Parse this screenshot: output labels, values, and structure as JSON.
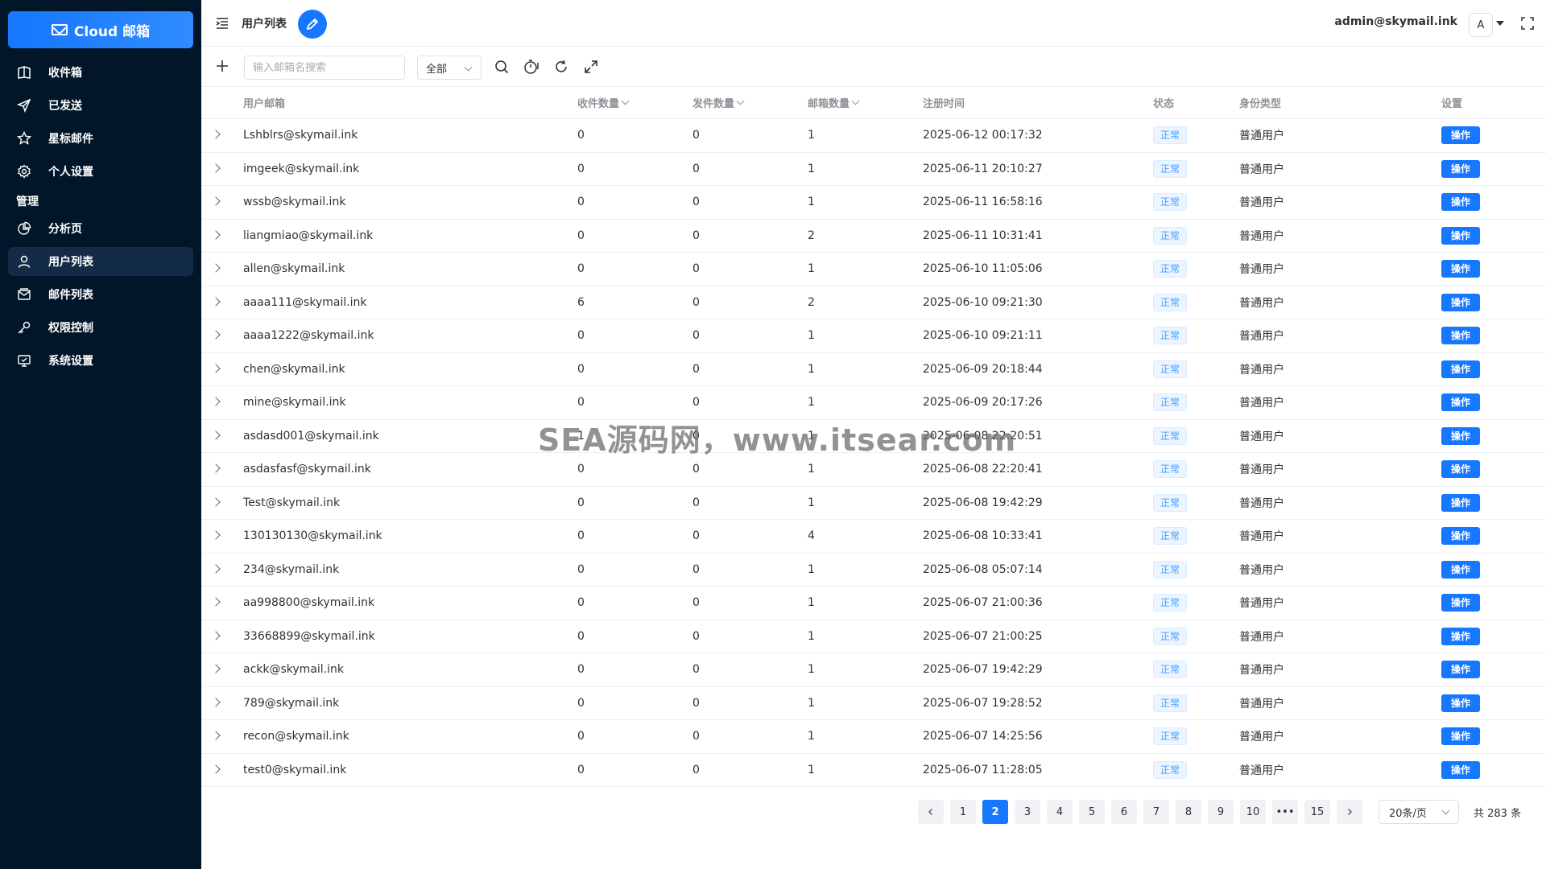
{
  "brand": {
    "label": "Cloud 邮箱"
  },
  "sidebar": {
    "items": [
      {
        "label": "收件箱",
        "icon": "inbox-icon"
      },
      {
        "label": "已发送",
        "icon": "send-icon"
      },
      {
        "label": "星标邮件",
        "icon": "star-icon"
      },
      {
        "label": "个人设置",
        "icon": "gear-icon"
      }
    ],
    "section_label": "管理",
    "admin_items": [
      {
        "label": "分析页",
        "icon": "pie-chart-icon"
      },
      {
        "label": "用户列表",
        "icon": "user-icon",
        "active": true
      },
      {
        "label": "邮件列表",
        "icon": "mail-list-icon"
      },
      {
        "label": "权限控制",
        "icon": "key-icon"
      },
      {
        "label": "系统设置",
        "icon": "monitor-icon"
      }
    ]
  },
  "header": {
    "title": "用户列表",
    "user_email": "admin@skymail.ink",
    "avatar_letter": "A"
  },
  "toolbar": {
    "search_placeholder": "输入邮箱名搜索",
    "filter_value": "全部"
  },
  "table": {
    "headers": {
      "email": "用户邮箱",
      "recv": "收件数量",
      "send": "发件数量",
      "mailbox": "邮箱数量",
      "time": "注册时间",
      "status": "状态",
      "role": "身份类型",
      "settings": "设置"
    },
    "rows": [
      {
        "email": "Lshblrs@skymail.ink",
        "recv": "0",
        "send": "0",
        "mailbox": "1",
        "time": "2025-06-12 00:17:32",
        "status": "正常",
        "role": "普通用户",
        "action": "操作"
      },
      {
        "email": "imgeek@skymail.ink",
        "recv": "0",
        "send": "0",
        "mailbox": "1",
        "time": "2025-06-11 20:10:27",
        "status": "正常",
        "role": "普通用户",
        "action": "操作"
      },
      {
        "email": "wssb@skymail.ink",
        "recv": "0",
        "send": "0",
        "mailbox": "1",
        "time": "2025-06-11 16:58:16",
        "status": "正常",
        "role": "普通用户",
        "action": "操作"
      },
      {
        "email": "liangmiao@skymail.ink",
        "recv": "0",
        "send": "0",
        "mailbox": "2",
        "time": "2025-06-11 10:31:41",
        "status": "正常",
        "role": "普通用户",
        "action": "操作"
      },
      {
        "email": "allen@skymail.ink",
        "recv": "0",
        "send": "0",
        "mailbox": "1",
        "time": "2025-06-10 11:05:06",
        "status": "正常",
        "role": "普通用户",
        "action": "操作"
      },
      {
        "email": "aaaa111@skymail.ink",
        "recv": "6",
        "send": "0",
        "mailbox": "2",
        "time": "2025-06-10 09:21:30",
        "status": "正常",
        "role": "普通用户",
        "action": "操作"
      },
      {
        "email": "aaaa1222@skymail.ink",
        "recv": "0",
        "send": "0",
        "mailbox": "1",
        "time": "2025-06-10 09:21:11",
        "status": "正常",
        "role": "普通用户",
        "action": "操作"
      },
      {
        "email": "chen@skymail.ink",
        "recv": "0",
        "send": "0",
        "mailbox": "1",
        "time": "2025-06-09 20:18:44",
        "status": "正常",
        "role": "普通用户",
        "action": "操作"
      },
      {
        "email": "mine@skymail.ink",
        "recv": "0",
        "send": "0",
        "mailbox": "1",
        "time": "2025-06-09 20:17:26",
        "status": "正常",
        "role": "普通用户",
        "action": "操作"
      },
      {
        "email": "asdasd001@skymail.ink",
        "recv": "1",
        "send": "0",
        "mailbox": "1",
        "time": "2025-06-08 22:20:51",
        "status": "正常",
        "role": "普通用户",
        "action": "操作"
      },
      {
        "email": "asdasfasf@skymail.ink",
        "recv": "0",
        "send": "0",
        "mailbox": "1",
        "time": "2025-06-08 22:20:41",
        "status": "正常",
        "role": "普通用户",
        "action": "操作"
      },
      {
        "email": "Test@skymail.ink",
        "recv": "0",
        "send": "0",
        "mailbox": "1",
        "time": "2025-06-08 19:42:29",
        "status": "正常",
        "role": "普通用户",
        "action": "操作"
      },
      {
        "email": "130130130@skymail.ink",
        "recv": "0",
        "send": "0",
        "mailbox": "4",
        "time": "2025-06-08 10:33:41",
        "status": "正常",
        "role": "普通用户",
        "action": "操作"
      },
      {
        "email": "234@skymail.ink",
        "recv": "0",
        "send": "0",
        "mailbox": "1",
        "time": "2025-06-08 05:07:14",
        "status": "正常",
        "role": "普通用户",
        "action": "操作"
      },
      {
        "email": "aa998800@skymail.ink",
        "recv": "0",
        "send": "0",
        "mailbox": "1",
        "time": "2025-06-07 21:00:36",
        "status": "正常",
        "role": "普通用户",
        "action": "操作"
      },
      {
        "email": "33668899@skymail.ink",
        "recv": "0",
        "send": "0",
        "mailbox": "1",
        "time": "2025-06-07 21:00:25",
        "status": "正常",
        "role": "普通用户",
        "action": "操作"
      },
      {
        "email": "ackk@skymail.ink",
        "recv": "0",
        "send": "0",
        "mailbox": "1",
        "time": "2025-06-07 19:42:29",
        "status": "正常",
        "role": "普通用户",
        "action": "操作"
      },
      {
        "email": "789@skymail.ink",
        "recv": "0",
        "send": "0",
        "mailbox": "1",
        "time": "2025-06-07 19:28:52",
        "status": "正常",
        "role": "普通用户",
        "action": "操作"
      },
      {
        "email": "recon@skymail.ink",
        "recv": "0",
        "send": "0",
        "mailbox": "1",
        "time": "2025-06-07 14:25:56",
        "status": "正常",
        "role": "普通用户",
        "action": "操作"
      },
      {
        "email": "test0@skymail.ink",
        "recv": "0",
        "send": "0",
        "mailbox": "1",
        "time": "2025-06-07 11:28:05",
        "status": "正常",
        "role": "普通用户",
        "action": "操作"
      }
    ]
  },
  "pagination": {
    "pages": [
      "1",
      "2",
      "3",
      "4",
      "5",
      "6",
      "7",
      "8",
      "9",
      "10",
      "•••",
      "15"
    ],
    "current": "2",
    "page_size": "20条/页",
    "total": "共 283 条"
  },
  "watermark": "SEA源码网，www.itsear.com",
  "colors": {
    "sidebar_bg": "#011629",
    "accent": "#1677ff"
  }
}
